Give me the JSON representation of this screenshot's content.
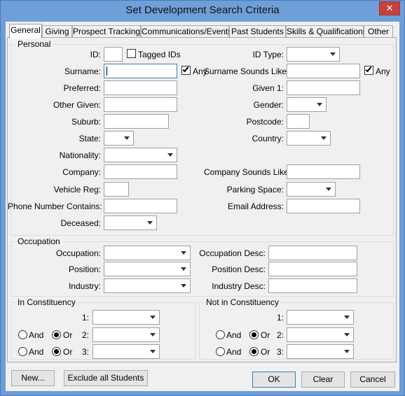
{
  "window": {
    "title": "Set Development Search Criteria",
    "close_glyph": "✕"
  },
  "tabs": [
    {
      "label": "General"
    },
    {
      "label": "Giving"
    },
    {
      "label": "Prospect Tracking"
    },
    {
      "label": "Communications/Events"
    },
    {
      "label": "Past Students"
    },
    {
      "label": "Skills & Qualifications"
    },
    {
      "label": "Other"
    }
  ],
  "personal": {
    "title": "Personal",
    "id_label": "ID:",
    "tagged_ids": "Tagged IDs",
    "id_type": "ID Type:",
    "surname": "Surname:",
    "any1": "Any",
    "surname_sounds": "Surname Sounds Like:",
    "any2": "Any",
    "preferred": "Preferred:",
    "given1": "Given 1:",
    "other_given": "Other Given:",
    "gender": "Gender:",
    "suburb": "Suburb:",
    "postcode": "Postcode:",
    "state": "State:",
    "country": "Country:",
    "nationality": "Nationality:",
    "company": "Company:",
    "company_sounds": "Company Sounds Like:",
    "vehicle_reg": "Vehicle Reg:",
    "parking_space": "Parking Space:",
    "phone": "Phone Number Contains:",
    "email": "Email Address:",
    "deceased": "Deceased:"
  },
  "occupation": {
    "title": "Occupation",
    "occupation": "Occupation:",
    "occupation_desc": "Occupation Desc:",
    "position": "Position:",
    "position_desc": "Position Desc:",
    "industry": "Industry:",
    "industry_desc": "Industry Desc:"
  },
  "in_constituency": {
    "title": "In Constituency",
    "n1": "1:",
    "n2": "2:",
    "n3": "3:",
    "and": "And",
    "or": "Or"
  },
  "not_in_constituency": {
    "title": "Not in Constituency",
    "n1": "1:",
    "n2": "2:",
    "n3": "3:",
    "and": "And",
    "or": "Or"
  },
  "buttons": {
    "new": "New...",
    "exclude": "Exclude all Students",
    "ok": "OK",
    "clear": "Clear",
    "cancel": "Cancel"
  }
}
